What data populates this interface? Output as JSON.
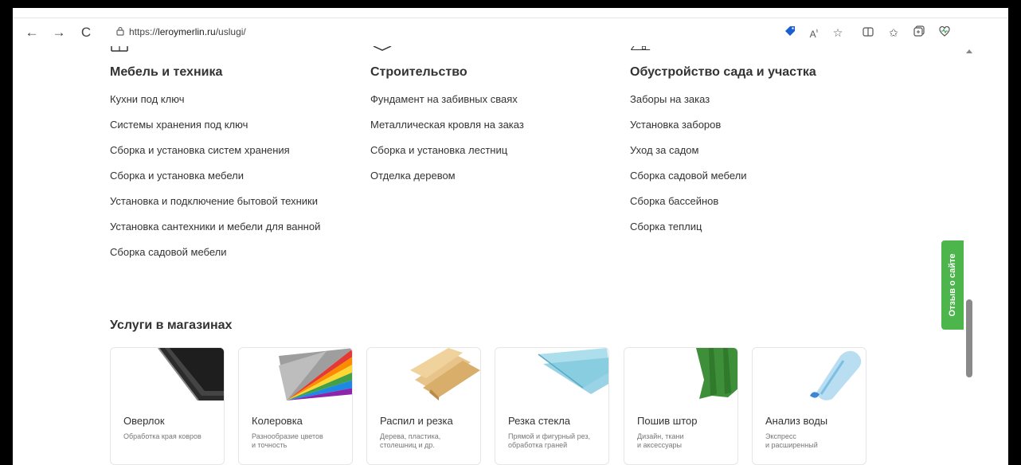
{
  "browser": {
    "url_prefix": "https://",
    "url_domain": "leroymerlin.ru",
    "url_path": "/uslugi/",
    "back_icon": "←",
    "forward_icon": "→",
    "reload_icon": "C"
  },
  "columns": [
    {
      "title": "Мебель и техника",
      "links": [
        "Кухни под ключ",
        "Системы хранения под ключ",
        "Сборка и установка систем хранения",
        "Сборка и установка мебели",
        "Установка и подключение бытовой техники",
        "Установка сантехники и мебели для ванной",
        "Сборка садовой мебели"
      ]
    },
    {
      "title": "Строительство",
      "links": [
        "Фундамент на забивных сваях",
        "Металлическая кровля на заказ",
        "Сборка и установка лестниц",
        "Отделка деревом"
      ]
    },
    {
      "title": "Обустройство сада и участка",
      "links": [
        "Заборы на заказ",
        "Установка заборов",
        "Уход за садом",
        "Сборка садовой мебели",
        "Сборка бассейнов",
        "Сборка теплиц"
      ]
    }
  ],
  "stores_section": {
    "title": "Услуги в магазинах",
    "cards": [
      {
        "title": "Оверлок",
        "subtitle": "Обработка края ковров"
      },
      {
        "title": "Колеровка",
        "subtitle": "Разнообразие цветов\nи точность"
      },
      {
        "title": "Распил и резка",
        "subtitle": "Дерева, пластика,\nстолешниц и др."
      },
      {
        "title": "Резка стекла",
        "subtitle": "Прямой и фигурный рез,\nобработка граней"
      },
      {
        "title": "Пошив штор",
        "subtitle": "Дизайн, ткани\nи аксессуары"
      },
      {
        "title": "Анализ воды",
        "subtitle": "Экспресс\nи расширенный"
      }
    ]
  },
  "feedback_tab": "Отзыв о сайте",
  "colors": {
    "accent_green": "#4cb64c",
    "text": "#333333",
    "subtext": "#777777"
  }
}
